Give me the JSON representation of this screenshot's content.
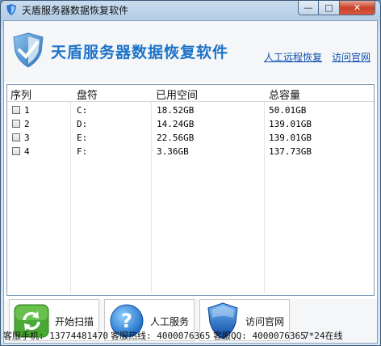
{
  "window": {
    "title": "天盾服务器数据恢复软件",
    "controls": {
      "minimize": "—",
      "maximize": "□",
      "close": "✕"
    }
  },
  "header": {
    "app_name": "天盾服务器数据恢复软件",
    "links": {
      "remote": "人工远程恢复",
      "site": "访问官网"
    }
  },
  "table": {
    "columns": [
      "序列",
      "盘符",
      "已用空间",
      "总容量"
    ],
    "rows": [
      {
        "index": "1",
        "drive": "C:",
        "used": "18.52GB",
        "total": "50.01GB"
      },
      {
        "index": "2",
        "drive": "D:",
        "used": "14.24GB",
        "total": "139.01GB"
      },
      {
        "index": "3",
        "drive": "E:",
        "used": "22.56GB",
        "total": "139.01GB"
      },
      {
        "index": "4",
        "drive": "F:",
        "used": "3.36GB",
        "total": "137.73GB"
      }
    ]
  },
  "buttons": {
    "scan": "开始扫描",
    "manual": "人工服务",
    "site": "访问官网"
  },
  "status": {
    "phone": "客服手机: 13774481470",
    "hotline": "客服热线: 4000076365",
    "qq": "客服QQ: 4000076365",
    "hours": "7*24在线"
  },
  "colors": {
    "accent": "#1e73c8",
    "link": "#0d4fb0",
    "close_button": "#c9412a"
  },
  "icons": {
    "logo": "shield-icon",
    "scan": "refresh-icon",
    "manual": "help-icon",
    "site": "shield-icon"
  }
}
